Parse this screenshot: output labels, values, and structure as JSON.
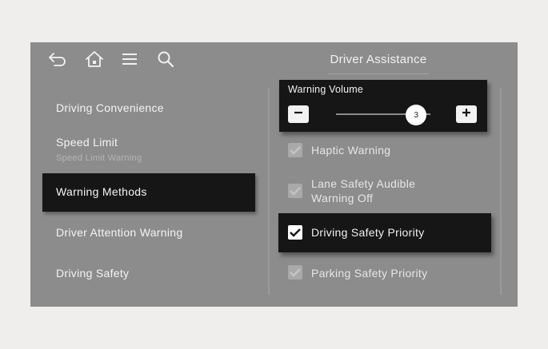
{
  "toolbar": {
    "icons": [
      "back-icon",
      "home-icon",
      "menu-icon",
      "search-icon"
    ]
  },
  "header": {
    "title": "Driver Assistance"
  },
  "sidebar": {
    "items": [
      {
        "label": "Driving Convenience",
        "sub": null,
        "active": false
      },
      {
        "label": "Speed Limit",
        "sub": "Speed Limit Warning",
        "active": false
      },
      {
        "label": "Warning Methods",
        "sub": null,
        "active": true
      },
      {
        "label": "Driver Attention Warning",
        "sub": null,
        "active": false
      },
      {
        "label": "Driving Safety",
        "sub": null,
        "active": false
      }
    ]
  },
  "volume": {
    "label": "Warning Volume",
    "value": "3",
    "level_fraction": 0.85,
    "minus_icon": "minus-icon",
    "plus_icon": "plus-icon"
  },
  "options": [
    {
      "label_line1": "Haptic Warning",
      "label_line2": "",
      "checked": true,
      "enabled": false,
      "active": false
    },
    {
      "label_line1": "Lane Safety Audible",
      "label_line2": "Warning Off",
      "checked": true,
      "enabled": false,
      "active": false
    },
    {
      "label_line1": "Driving Safety Priority",
      "label_line2": "",
      "checked": true,
      "enabled": true,
      "active": true
    },
    {
      "label_line1": "Parking Safety Priority",
      "label_line2": "",
      "checked": true,
      "enabled": false,
      "active": false
    }
  ],
  "colors": {
    "screen_bg": "#8c8c8c",
    "panel_bg": "#161616",
    "text": "#f4f4f4",
    "outer_bg": "#efeeec"
  }
}
